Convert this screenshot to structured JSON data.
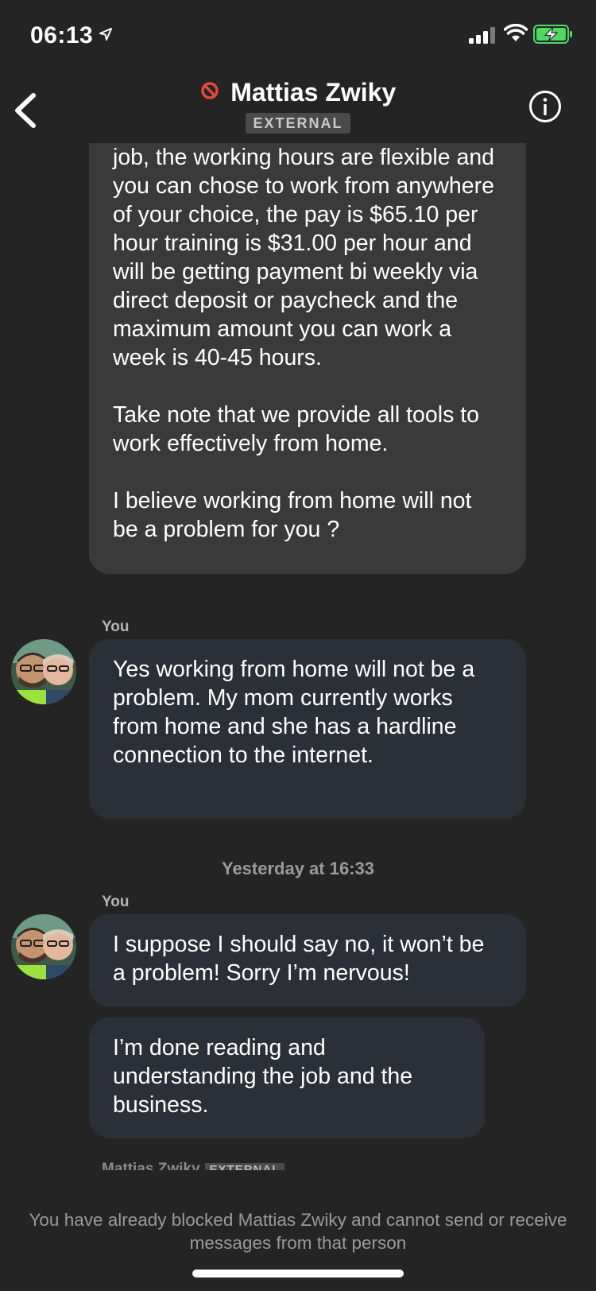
{
  "status_bar": {
    "time": "06:13"
  },
  "header": {
    "contact_name": "Mattias Zwiky",
    "badge": "EXTERNAL",
    "status_icon": "blocked-icon",
    "back_icon": "chevron-left-icon",
    "info_icon": "info-icon"
  },
  "messages": [
    {
      "direction": "incoming",
      "text": "job, the working hours are flexible and you can chose to work from anywhere of your choice, the pay is $65.10 per hour training is $31.00 per hour and will be getting payment bi weekly via direct deposit or paycheck and the maximum amount you can work a week is 40-45 hours.\n\nTake note that we provide all tools to work effectively from home.\n\nI believe working from home will not be a problem for you ?"
    },
    {
      "direction": "outgoing",
      "sender": "You",
      "text": "Yes working from home will not be a problem. My mom currently works from home and she has a hardline connection to the internet."
    },
    {
      "direction": "outgoing",
      "sender": "You",
      "text": "I suppose I should say no, it won’t be a problem! Sorry I’m nervous!"
    },
    {
      "direction": "outgoing",
      "text": "I’m done reading and understanding the job and the business."
    }
  ],
  "timestamp": "Yesterday at 16:33",
  "clipped_sender": {
    "name": "Mattias Zwiky",
    "badge": "EXTERNAL"
  },
  "blocked_notice": "You have already blocked Mattias Zwiky and cannot send or receive messages from that person",
  "colors": {
    "background": "#242424",
    "incoming_bubble": "#3a3a3a",
    "outgoing_bubble": "#2b2f37",
    "blocked_red": "#e5493a",
    "battery_green": "#4cd964"
  }
}
